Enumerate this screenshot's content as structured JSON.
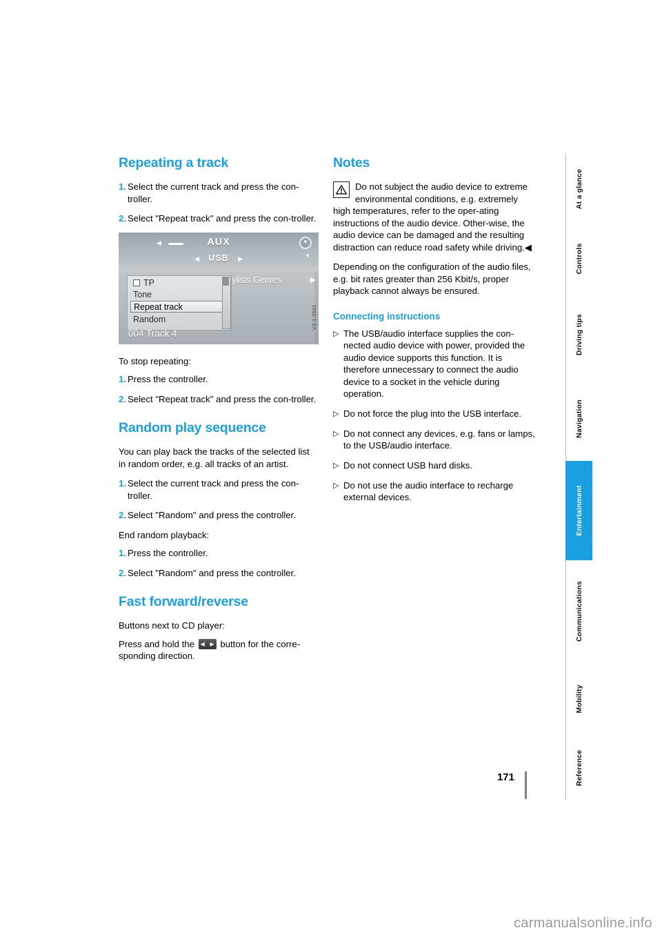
{
  "page": {
    "number": "171",
    "watermark": "carmanualsonline.info"
  },
  "tabs": [
    {
      "label": "At a glance",
      "active": false
    },
    {
      "label": "Controls",
      "active": false
    },
    {
      "label": "Driving tips",
      "active": false
    },
    {
      "label": "Navigation",
      "active": false
    },
    {
      "label": "Entertainment",
      "active": true
    },
    {
      "label": "Communications",
      "active": false
    },
    {
      "label": "Mobility",
      "active": false
    },
    {
      "label": "Reference",
      "active": false
    }
  ],
  "left_column": {
    "heading_repeat": "Repeating a track",
    "repeat_steps": [
      {
        "num": "1.",
        "text": "Select the current track and press the con-troller."
      },
      {
        "num": "2.",
        "text": "Select \"Repeat track\" and press the con-troller."
      }
    ],
    "figure": {
      "aux_label": "AUX",
      "usb_label": "USB",
      "menu_items": [
        "TP",
        "Tone",
        "Repeat track",
        "Random"
      ],
      "selected_item": "Repeat track",
      "tabs_text": "ylists    Genres",
      "track_label": "004 Track 4",
      "code": "V3-1-0501"
    },
    "stop_heading": "To stop repeating:",
    "stop_steps": [
      {
        "num": "1.",
        "text": "Press the controller."
      },
      {
        "num": "2.",
        "text": "Select \"Repeat track\" and press the con-troller."
      }
    ],
    "heading_random": "Random play sequence",
    "random_intro": "You can play back the tracks of the selected list in random order, e.g. all tracks of an artist.",
    "random_steps": [
      {
        "num": "1.",
        "text": "Select the current track and press the con-troller."
      },
      {
        "num": "2.",
        "text": "Select \"Random\" and press the controller."
      }
    ],
    "end_heading": "End random playback:",
    "end_steps": [
      {
        "num": "1.",
        "text": "Press the controller."
      },
      {
        "num": "2.",
        "text": "Select \"Random\" and press the controller."
      }
    ],
    "heading_fast": "Fast forward/reverse",
    "fast_line1": "Buttons next to CD player:",
    "fast_line2_a": "Press and hold the",
    "fast_line2_b": "button for the corre-sponding direction."
  },
  "right_column": {
    "heading_notes": "Notes",
    "warning_text": "Do not subject the audio device to extreme environmental conditions, e.g. extremely high temperatures, refer to the oper-ating instructions of the audio device. Other-wise, the audio device can be damaged and the resulting distraction can reduce road safety while driving.",
    "warning_end_mark": "◀",
    "note_paragraph": "Depending on the configuration of the audio files, e.g. bit rates greater than 256 Kbit/s, proper playback cannot always be ensured.",
    "heading_connecting": "Connecting instructions",
    "bullets": [
      "The USB/audio interface supplies the con-nected audio device with power, provided the audio device supports this function. It is therefore unnecessary to connect the audio device to a socket in the vehicle during operation.",
      "Do not force the plug into the USB interface.",
      "Do not connect any devices, e.g. fans or lamps, to the USB/audio interface.",
      "Do not connect USB hard disks.",
      "Do not use the audio interface to recharge external devices."
    ],
    "bullet_marker": "▷"
  },
  "colors": {
    "accent": "#1a9fe0",
    "text": "#000000",
    "rule": "#7c8388"
  }
}
